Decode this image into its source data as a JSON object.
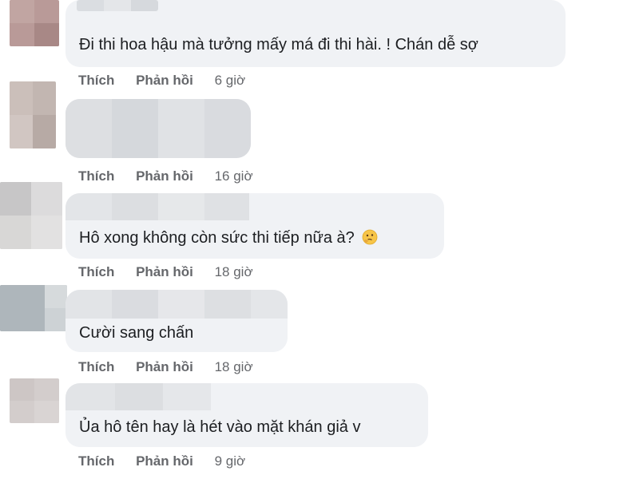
{
  "comments": [
    {
      "text": "Đi thi hoa hậu mà tưởng mấy má đi thi hài. ! Chán dễ sợ",
      "like_label": "Thích",
      "reply_label": "Phản hồi",
      "time": "6 giờ"
    },
    {
      "text": "",
      "like_label": "Thích",
      "reply_label": "Phản hồi",
      "time": "16 giờ"
    },
    {
      "text": "Hô xong không còn sức thi tiếp nữa à?",
      "emoji": "thinking-face-icon",
      "like_label": "Thích",
      "reply_label": "Phản hồi",
      "time": "18 giờ"
    },
    {
      "text": "Cười sang chấn",
      "like_label": "Thích",
      "reply_label": "Phản hồi",
      "time": "18 giờ"
    },
    {
      "text": "Ủa hô tên hay là hét vào mặt khán giả v",
      "like_label": "Thích",
      "reply_label": "Phản hồi",
      "time": "9 giờ"
    }
  ],
  "colors": {
    "bubble": "#f0f2f5",
    "text": "#1c1e21",
    "meta": "#65676b"
  }
}
